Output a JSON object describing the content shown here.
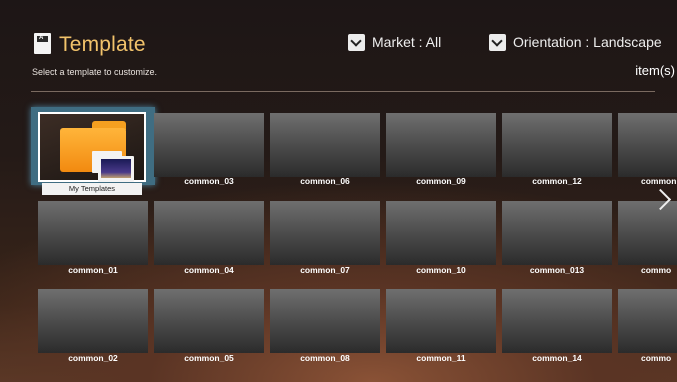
{
  "header": {
    "title": "Template",
    "subtitle": "Select a template to customize.",
    "market_label": "Market : All",
    "orientation_label": "Orientation : Landscape",
    "items_label": "item(s)"
  },
  "focused_tile": {
    "label": "My Templates"
  },
  "tiles": [
    "common_03",
    "common_06",
    "common_09",
    "common_12",
    "common",
    "common_01",
    "common_04",
    "common_07",
    "common_10",
    "common_013",
    "commo",
    "common_02",
    "common_05",
    "common_08",
    "common_11",
    "common_14",
    "commo"
  ]
}
